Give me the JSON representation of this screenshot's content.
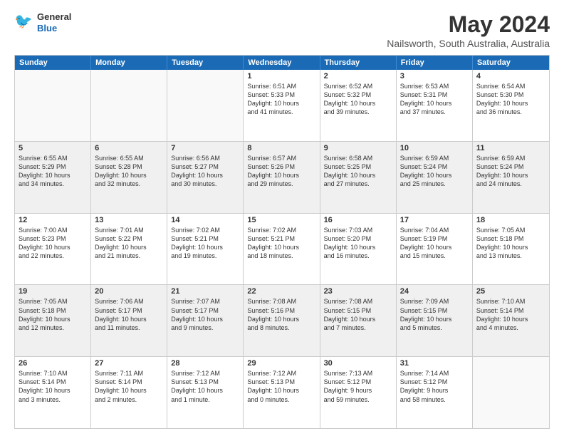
{
  "logo": {
    "general": "General",
    "blue": "Blue"
  },
  "title": "May 2024",
  "subtitle": "Nailsworth, South Australia, Australia",
  "days": [
    "Sunday",
    "Monday",
    "Tuesday",
    "Wednesday",
    "Thursday",
    "Friday",
    "Saturday"
  ],
  "rows": [
    [
      {
        "num": "",
        "info": "",
        "empty": true
      },
      {
        "num": "",
        "info": "",
        "empty": true
      },
      {
        "num": "",
        "info": "",
        "empty": true
      },
      {
        "num": "1",
        "info": "Sunrise: 6:51 AM\nSunset: 5:33 PM\nDaylight: 10 hours\nand 41 minutes."
      },
      {
        "num": "2",
        "info": "Sunrise: 6:52 AM\nSunset: 5:32 PM\nDaylight: 10 hours\nand 39 minutes."
      },
      {
        "num": "3",
        "info": "Sunrise: 6:53 AM\nSunset: 5:31 PM\nDaylight: 10 hours\nand 37 minutes."
      },
      {
        "num": "4",
        "info": "Sunrise: 6:54 AM\nSunset: 5:30 PM\nDaylight: 10 hours\nand 36 minutes."
      }
    ],
    [
      {
        "num": "5",
        "info": "Sunrise: 6:55 AM\nSunset: 5:29 PM\nDaylight: 10 hours\nand 34 minutes."
      },
      {
        "num": "6",
        "info": "Sunrise: 6:55 AM\nSunset: 5:28 PM\nDaylight: 10 hours\nand 32 minutes."
      },
      {
        "num": "7",
        "info": "Sunrise: 6:56 AM\nSunset: 5:27 PM\nDaylight: 10 hours\nand 30 minutes."
      },
      {
        "num": "8",
        "info": "Sunrise: 6:57 AM\nSunset: 5:26 PM\nDaylight: 10 hours\nand 29 minutes."
      },
      {
        "num": "9",
        "info": "Sunrise: 6:58 AM\nSunset: 5:25 PM\nDaylight: 10 hours\nand 27 minutes."
      },
      {
        "num": "10",
        "info": "Sunrise: 6:59 AM\nSunset: 5:24 PM\nDaylight: 10 hours\nand 25 minutes."
      },
      {
        "num": "11",
        "info": "Sunrise: 6:59 AM\nSunset: 5:24 PM\nDaylight: 10 hours\nand 24 minutes."
      }
    ],
    [
      {
        "num": "12",
        "info": "Sunrise: 7:00 AM\nSunset: 5:23 PM\nDaylight: 10 hours\nand 22 minutes."
      },
      {
        "num": "13",
        "info": "Sunrise: 7:01 AM\nSunset: 5:22 PM\nDaylight: 10 hours\nand 21 minutes."
      },
      {
        "num": "14",
        "info": "Sunrise: 7:02 AM\nSunset: 5:21 PM\nDaylight: 10 hours\nand 19 minutes."
      },
      {
        "num": "15",
        "info": "Sunrise: 7:02 AM\nSunset: 5:21 PM\nDaylight: 10 hours\nand 18 minutes."
      },
      {
        "num": "16",
        "info": "Sunrise: 7:03 AM\nSunset: 5:20 PM\nDaylight: 10 hours\nand 16 minutes."
      },
      {
        "num": "17",
        "info": "Sunrise: 7:04 AM\nSunset: 5:19 PM\nDaylight: 10 hours\nand 15 minutes."
      },
      {
        "num": "18",
        "info": "Sunrise: 7:05 AM\nSunset: 5:18 PM\nDaylight: 10 hours\nand 13 minutes."
      }
    ],
    [
      {
        "num": "19",
        "info": "Sunrise: 7:05 AM\nSunset: 5:18 PM\nDaylight: 10 hours\nand 12 minutes."
      },
      {
        "num": "20",
        "info": "Sunrise: 7:06 AM\nSunset: 5:17 PM\nDaylight: 10 hours\nand 11 minutes."
      },
      {
        "num": "21",
        "info": "Sunrise: 7:07 AM\nSunset: 5:17 PM\nDaylight: 10 hours\nand 9 minutes."
      },
      {
        "num": "22",
        "info": "Sunrise: 7:08 AM\nSunset: 5:16 PM\nDaylight: 10 hours\nand 8 minutes."
      },
      {
        "num": "23",
        "info": "Sunrise: 7:08 AM\nSunset: 5:15 PM\nDaylight: 10 hours\nand 7 minutes."
      },
      {
        "num": "24",
        "info": "Sunrise: 7:09 AM\nSunset: 5:15 PM\nDaylight: 10 hours\nand 5 minutes."
      },
      {
        "num": "25",
        "info": "Sunrise: 7:10 AM\nSunset: 5:14 PM\nDaylight: 10 hours\nand 4 minutes."
      }
    ],
    [
      {
        "num": "26",
        "info": "Sunrise: 7:10 AM\nSunset: 5:14 PM\nDaylight: 10 hours\nand 3 minutes."
      },
      {
        "num": "27",
        "info": "Sunrise: 7:11 AM\nSunset: 5:14 PM\nDaylight: 10 hours\nand 2 minutes."
      },
      {
        "num": "28",
        "info": "Sunrise: 7:12 AM\nSunset: 5:13 PM\nDaylight: 10 hours\nand 1 minute."
      },
      {
        "num": "29",
        "info": "Sunrise: 7:12 AM\nSunset: 5:13 PM\nDaylight: 10 hours\nand 0 minutes."
      },
      {
        "num": "30",
        "info": "Sunrise: 7:13 AM\nSunset: 5:12 PM\nDaylight: 9 hours\nand 59 minutes."
      },
      {
        "num": "31",
        "info": "Sunrise: 7:14 AM\nSunset: 5:12 PM\nDaylight: 9 hours\nand 58 minutes."
      },
      {
        "num": "",
        "info": "",
        "empty": true
      }
    ]
  ]
}
